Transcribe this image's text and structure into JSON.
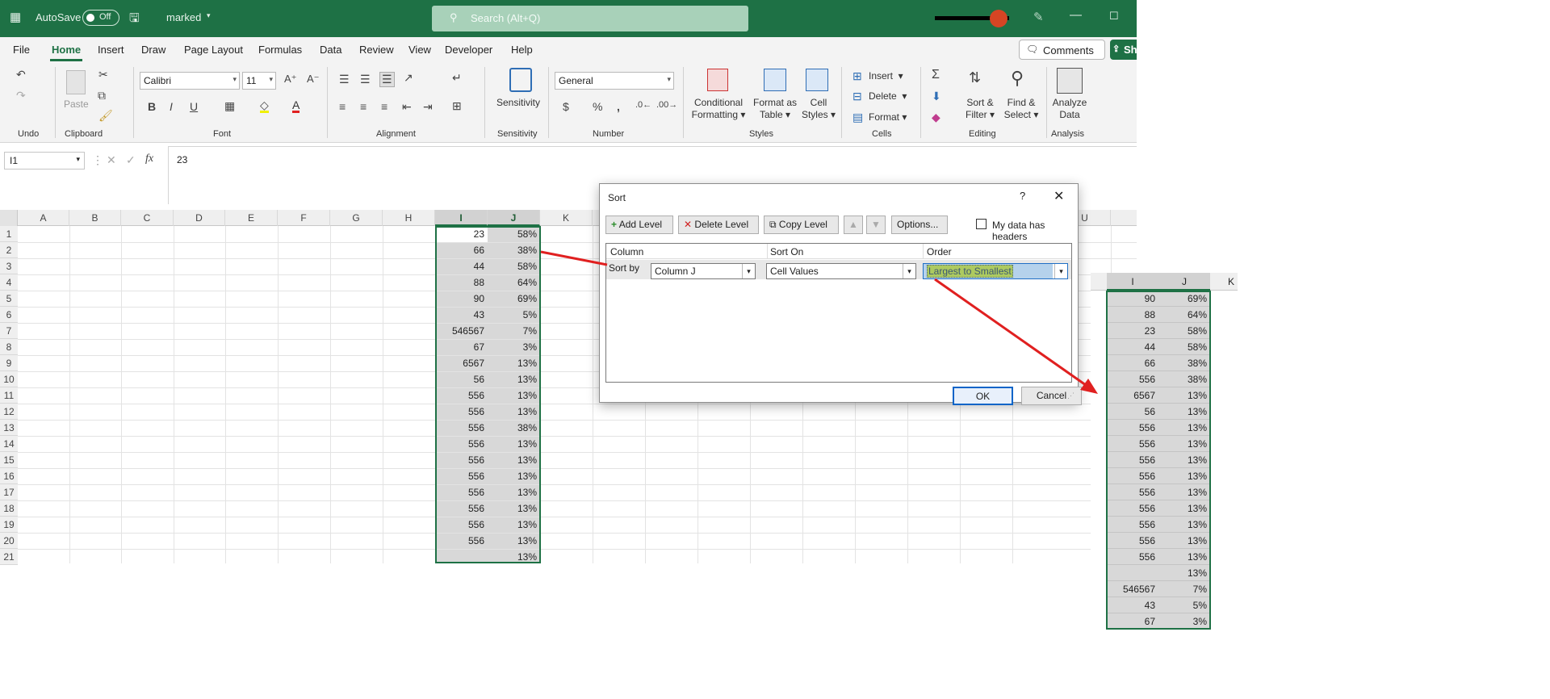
{
  "titlebar": {
    "autosave_label": "AutoSave",
    "autosave_state": "Off",
    "filename": "marked",
    "search_placeholder": "Search (Alt+Q)"
  },
  "menu": {
    "items": [
      "File",
      "Home",
      "Insert",
      "Draw",
      "Page Layout",
      "Formulas",
      "Data",
      "Review",
      "View",
      "Developer",
      "Help"
    ],
    "active": "Home",
    "comments_label": "Comments",
    "share_label": "Sh"
  },
  "ribbon": {
    "groups": {
      "undo": "Undo",
      "clipboard": "Clipboard",
      "font": "Font",
      "alignment": "Alignment",
      "sensitivity": "Sensitivity",
      "number": "Number",
      "styles": "Styles",
      "cells": "Cells",
      "editing": "Editing",
      "analysis": "Analysis"
    },
    "paste_label": "Paste",
    "font_name": "Calibri",
    "font_size": "11",
    "sensitivity_label": "Sensitivity",
    "number_format": "General",
    "conditional_formatting": [
      "Conditional",
      "Formatting"
    ],
    "format_as_table": [
      "Format as",
      "Table"
    ],
    "cell_styles": [
      "Cell",
      "Styles"
    ],
    "insert_label": "Insert",
    "delete_label": "Delete",
    "format_label": "Format",
    "sort_filter": [
      "Sort &",
      "Filter"
    ],
    "find_select": [
      "Find &",
      "Select"
    ],
    "analyze_data": [
      "Analyze",
      "Data"
    ]
  },
  "formula_bar": {
    "name_box": "I1",
    "formula": "23"
  },
  "sheet": {
    "columns": [
      "A",
      "B",
      "C",
      "D",
      "E",
      "F",
      "G",
      "H",
      "I",
      "J",
      "K",
      "U"
    ],
    "rows": [
      {
        "n": "1",
        "i": "23",
        "j": "58%"
      },
      {
        "n": "2",
        "i": "66",
        "j": "38%"
      },
      {
        "n": "3",
        "i": "44",
        "j": "58%"
      },
      {
        "n": "4",
        "i": "88",
        "j": "64%"
      },
      {
        "n": "5",
        "i": "90",
        "j": "69%"
      },
      {
        "n": "6",
        "i": "43",
        "j": "5%"
      },
      {
        "n": "7",
        "i": "546567",
        "j": "7%"
      },
      {
        "n": "8",
        "i": "67",
        "j": "3%"
      },
      {
        "n": "9",
        "i": "6567",
        "j": "13%"
      },
      {
        "n": "10",
        "i": "56",
        "j": "13%"
      },
      {
        "n": "11",
        "i": "556",
        "j": "13%"
      },
      {
        "n": "12",
        "i": "556",
        "j": "13%"
      },
      {
        "n": "13",
        "i": "556",
        "j": "38%"
      },
      {
        "n": "14",
        "i": "556",
        "j": "13%"
      },
      {
        "n": "15",
        "i": "556",
        "j": "13%"
      },
      {
        "n": "16",
        "i": "556",
        "j": "13%"
      },
      {
        "n": "17",
        "i": "556",
        "j": "13%"
      },
      {
        "n": "18",
        "i": "556",
        "j": "13%"
      },
      {
        "n": "19",
        "i": "556",
        "j": "13%"
      },
      {
        "n": "20",
        "i": "556",
        "j": "13%"
      },
      {
        "n": "21",
        "i": "",
        "j": "13%"
      }
    ]
  },
  "dialog": {
    "title": "Sort",
    "help": "?",
    "add_level": "Add Level",
    "delete_level": "Delete Level",
    "copy_level": "Copy Level",
    "options": "Options...",
    "headers_checkbox": "My data has headers",
    "col_column": "Column",
    "col_sort_on": "Sort On",
    "col_order": "Order",
    "sort_by": "Sort by",
    "column_value": "Column J",
    "sort_on_value": "Cell Values",
    "order_value": "Largest to Smallest",
    "ok": "OK",
    "cancel": "Cancel"
  },
  "sorted_panel": {
    "headers": [
      "I",
      "J",
      "K"
    ],
    "rows": [
      {
        "i": "90",
        "j": "69%"
      },
      {
        "i": "88",
        "j": "64%"
      },
      {
        "i": "23",
        "j": "58%"
      },
      {
        "i": "44",
        "j": "58%"
      },
      {
        "i": "66",
        "j": "38%"
      },
      {
        "i": "556",
        "j": "38%"
      },
      {
        "i": "6567",
        "j": "13%"
      },
      {
        "i": "56",
        "j": "13%"
      },
      {
        "i": "556",
        "j": "13%"
      },
      {
        "i": "556",
        "j": "13%"
      },
      {
        "i": "556",
        "j": "13%"
      },
      {
        "i": "556",
        "j": "13%"
      },
      {
        "i": "556",
        "j": "13%"
      },
      {
        "i": "556",
        "j": "13%"
      },
      {
        "i": "556",
        "j": "13%"
      },
      {
        "i": "556",
        "j": "13%"
      },
      {
        "i": "556",
        "j": "13%"
      },
      {
        "i": "",
        "j": "13%"
      },
      {
        "i": "546567",
        "j": "7%"
      },
      {
        "i": "43",
        "j": "5%"
      },
      {
        "i": "67",
        "j": "3%"
      }
    ]
  },
  "colors": {
    "excel_green": "#1e7145",
    "arrow_red": "#e02020",
    "highlight_yellow": "#f0f000",
    "selection_blue": "#5b9bd5"
  }
}
